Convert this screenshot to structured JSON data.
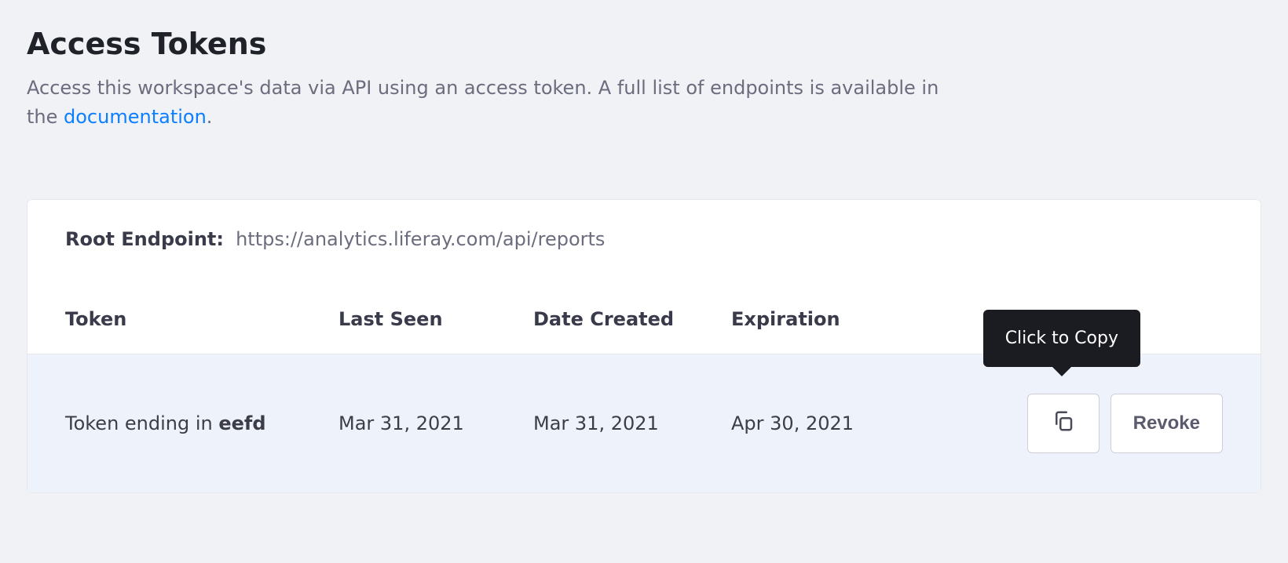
{
  "title": "Access Tokens",
  "description_prefix": "Access this workspace's data via API using an access token. A full list of endpoints is available in the ",
  "description_link": "documentation",
  "description_suffix": ".",
  "endpoint": {
    "label": "Root Endpoint:",
    "url": "https://analytics.liferay.com/api/reports"
  },
  "columns": {
    "token": "Token",
    "last_seen": "Last Seen",
    "date_created": "Date Created",
    "expiration": "Expiration"
  },
  "rows": [
    {
      "token_prefix": "Token ending in ",
      "token_suffix": "eefd",
      "last_seen": "Mar 31, 2021",
      "date_created": "Mar 31, 2021",
      "expiration": "Apr 30, 2021"
    }
  ],
  "actions": {
    "copy_tooltip": "Click to Copy",
    "revoke": "Revoke"
  }
}
